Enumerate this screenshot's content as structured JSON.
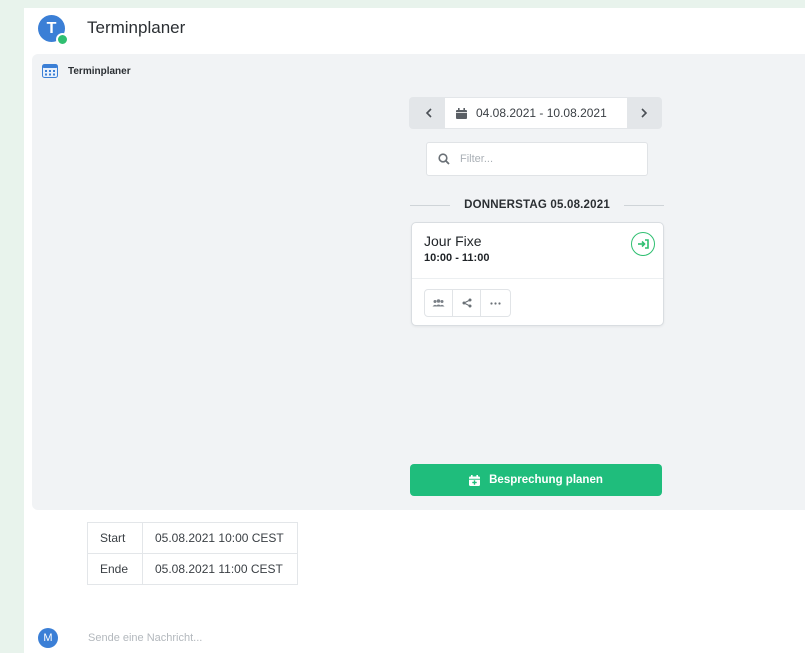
{
  "header": {
    "avatar_letter": "T",
    "title": "Terminplaner"
  },
  "panel": {
    "title": "Terminplaner",
    "date_range": "04.08.2021 - 10.08.2021",
    "filter_placeholder": "Filter...",
    "day_label": "DONNERSTAG 05.08.2021",
    "event": {
      "title": "Jour Fixe",
      "time": "10:00 - 11:00"
    },
    "schedule_button": "Besprechung planen"
  },
  "info": {
    "rows": [
      {
        "key": "Start",
        "value": "05.08.2021 10:00 CEST"
      },
      {
        "key": "Ende",
        "value": "05.08.2021 11:00 CEST"
      }
    ]
  },
  "composer": {
    "avatar_letter": "M",
    "placeholder": "Sende eine Nachricht..."
  },
  "colors": {
    "accent_green": "#1fbd7c",
    "avatar_blue": "#3b7fd6",
    "page_bg": "#e8f3ec"
  }
}
